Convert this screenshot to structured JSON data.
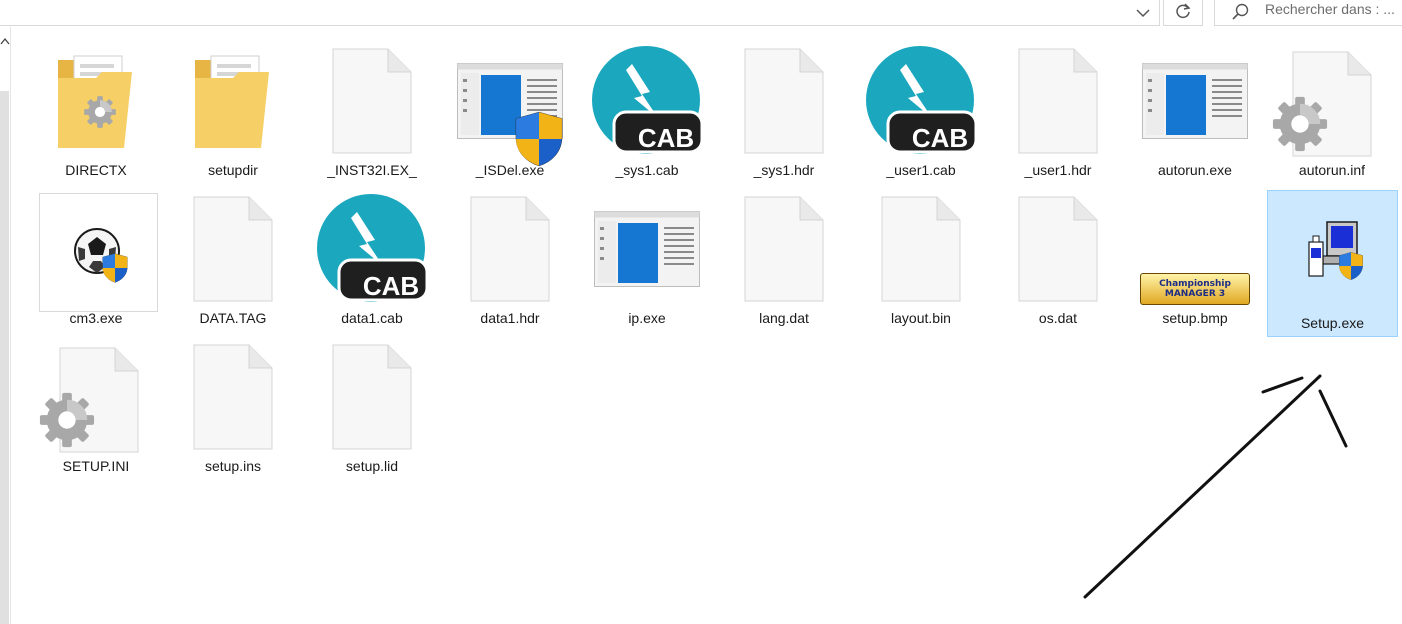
{
  "search": {
    "placeholder": "Rechercher dans : ..."
  },
  "colors": {
    "selection": "#cce8ff",
    "selection_border": "#99d1ff",
    "cab": "#1ba8bf",
    "folder": "#f4c95b"
  },
  "files": [
    {
      "name": "DIRECTX",
      "icon": "folder-icon"
    },
    {
      "name": "setupdir",
      "icon": "folder-icon"
    },
    {
      "name": "_INST32I.EX_",
      "icon": "blank-file-icon"
    },
    {
      "name": "_ISDel.exe",
      "icon": "app-window-shield-icon"
    },
    {
      "name": "_sys1.cab",
      "icon": "cab-icon",
      "badge": "CAB"
    },
    {
      "name": "_sys1.hdr",
      "icon": "blank-file-icon"
    },
    {
      "name": "_user1.cab",
      "icon": "cab-icon",
      "badge": "CAB"
    },
    {
      "name": "_user1.hdr",
      "icon": "blank-file-icon"
    },
    {
      "name": "autorun.exe",
      "icon": "app-window-icon"
    },
    {
      "name": "autorun.inf",
      "icon": "settings-file-icon"
    },
    {
      "name": "cm3.exe",
      "icon": "soccer-ball-shield-icon"
    },
    {
      "name": "DATA.TAG",
      "icon": "blank-file-icon"
    },
    {
      "name": "data1.cab",
      "icon": "cab-icon",
      "badge": "CAB"
    },
    {
      "name": "data1.hdr",
      "icon": "blank-file-icon"
    },
    {
      "name": "ip.exe",
      "icon": "app-window-icon"
    },
    {
      "name": "lang.dat",
      "icon": "blank-file-icon"
    },
    {
      "name": "layout.bin",
      "icon": "blank-file-icon"
    },
    {
      "name": "os.dat",
      "icon": "blank-file-icon"
    },
    {
      "name": "setup.bmp",
      "icon": "championship-manager-thumbnail",
      "logo_text": "Championship MANAGER 3"
    },
    {
      "name": "Setup.exe",
      "icon": "installer-shield-icon",
      "selected": true
    },
    {
      "name": "SETUP.INI",
      "icon": "settings-file-icon"
    },
    {
      "name": "setup.ins",
      "icon": "blank-file-icon"
    },
    {
      "name": "setup.lid",
      "icon": "blank-file-icon"
    }
  ]
}
